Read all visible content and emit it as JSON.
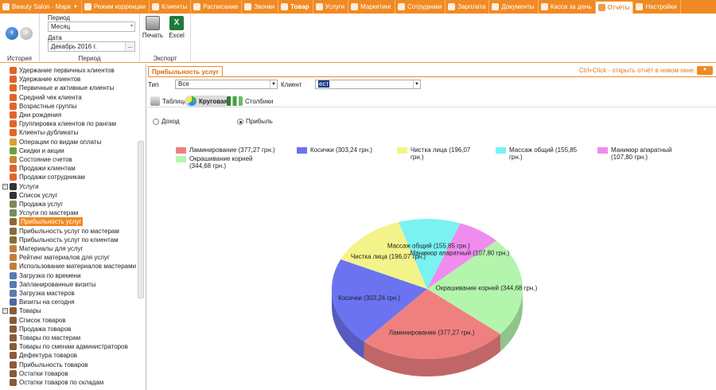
{
  "menubar": {
    "items": [
      {
        "label": "Beauty Salon - Марк",
        "caret": "▼",
        "bold": false,
        "active": false,
        "color": "#ffffff"
      },
      {
        "label": "Режим коррекции",
        "bold": false,
        "active": false
      },
      {
        "label": "Клиенты",
        "bold": false,
        "active": false
      },
      {
        "label": "Расписание",
        "bold": false,
        "active": false
      },
      {
        "label": "Звонки",
        "bold": false,
        "active": false
      },
      {
        "label": "Товар",
        "bold": true,
        "active": false
      },
      {
        "label": "Услуги",
        "bold": false,
        "active": false
      },
      {
        "label": "Маркетинг",
        "bold": false,
        "active": false
      },
      {
        "label": "Сотрудники",
        "bold": false,
        "active": false
      },
      {
        "label": "Зарплата",
        "bold": false,
        "active": false
      },
      {
        "label": "Документы",
        "bold": false,
        "active": false
      },
      {
        "label": "Касса за день",
        "bold": false,
        "active": false
      },
      {
        "label": "Отчёты",
        "bold": false,
        "active": true
      },
      {
        "label": "Настройки",
        "bold": false,
        "active": false
      }
    ]
  },
  "ribbon": {
    "history_label": "История",
    "period_group_label": "Период",
    "period_label": "Период",
    "period_value": "Месяц",
    "date_label": "Дата",
    "date_value": "Декабрь 2016 г.",
    "date_button": "...",
    "export_group_label": "Экспорт",
    "print_label": "Печать",
    "excel_label": "Excel",
    "excel_glyph": "X"
  },
  "sidebar": {
    "items": [
      {
        "label": "Удержание первичных клиентов",
        "level": 1,
        "icon": "person-icon"
      },
      {
        "label": "Удержание клиентов",
        "level": 1,
        "icon": "person-icon"
      },
      {
        "label": "Первичные и активные клиенты",
        "level": 1,
        "icon": "person-icon"
      },
      {
        "label": "Средний чек клиента",
        "level": 1,
        "icon": "person-icon"
      },
      {
        "label": "Возрастные группы",
        "level": 1,
        "icon": "person-icon"
      },
      {
        "label": "Дни рождения",
        "level": 1,
        "icon": "person-icon"
      },
      {
        "label": "Группировка клиентов по рангам",
        "level": 1,
        "icon": "person-icon"
      },
      {
        "label": "Клиенты-дубликаты",
        "level": 1,
        "icon": "person-icon"
      },
      {
        "label": "Операции по видам оплаты",
        "level": 1,
        "icon": "money-icon"
      },
      {
        "label": "Скидки и акции",
        "level": 1,
        "icon": "discount-icon"
      },
      {
        "label": "Состояние счетов",
        "level": 1,
        "icon": "account-icon"
      },
      {
        "label": "Продажи клиентам",
        "level": 1,
        "icon": "person-icon"
      },
      {
        "label": "Продажи сотрудникам",
        "level": 1,
        "icon": "person-icon"
      },
      {
        "label": "Услуги",
        "level": 0,
        "icon": "service-icon",
        "expander": "−"
      },
      {
        "label": "Список услуг",
        "level": 1,
        "icon": "service-icon"
      },
      {
        "label": "Продажа услуг",
        "level": 1,
        "icon": "sale-icon"
      },
      {
        "label": "Услуги по мастерам",
        "level": 1,
        "icon": "sale-icon"
      },
      {
        "label": "Прибыльность услуг",
        "level": 1,
        "icon": "profit-icon",
        "selected": true
      },
      {
        "label": "Прибыльность услуг по мастерам",
        "level": 1,
        "icon": "profit-icon"
      },
      {
        "label": "Прибыльность услуг по клиентам",
        "level": 1,
        "icon": "profit-icon"
      },
      {
        "label": "Материалы для услуг",
        "level": 1,
        "icon": "material-icon"
      },
      {
        "label": "Рейтинг материалов для услуг",
        "level": 1,
        "icon": "material-icon"
      },
      {
        "label": "Использование материалов мастерами",
        "level": 1,
        "icon": "material-icon"
      },
      {
        "label": "Загрузка по времени",
        "level": 1,
        "icon": "schedule-icon"
      },
      {
        "label": "Запланированные визиты",
        "level": 1,
        "icon": "schedule-icon"
      },
      {
        "label": "Загрузка мастеров",
        "level": 1,
        "icon": "schedule-icon"
      },
      {
        "label": "Визиты на сегодня",
        "level": 1,
        "icon": "calendar-icon"
      },
      {
        "label": "Товары",
        "level": 0,
        "icon": "goods-icon",
        "expander": "−"
      },
      {
        "label": "Список товаров",
        "level": 1,
        "icon": "goods-icon"
      },
      {
        "label": "Продажа товаров",
        "level": 1,
        "icon": "goods-icon"
      },
      {
        "label": "Товары по мастерам",
        "level": 1,
        "icon": "goods-icon"
      },
      {
        "label": "Товары по сменам администраторов",
        "level": 1,
        "icon": "goods-icon"
      },
      {
        "label": "Дефектура товаров",
        "level": 1,
        "icon": "goods-icon"
      },
      {
        "label": "Прибыльность товаров",
        "level": 1,
        "icon": "goods-icon"
      },
      {
        "label": "Остатки товаров",
        "level": 1,
        "icon": "goods-icon"
      },
      {
        "label": "Остатки товаров по складам",
        "level": 1,
        "icon": "goods-icon"
      }
    ]
  },
  "main": {
    "tab_label": "Прибыльность услуг",
    "hint": "Ctrl+Click - открыть отчёт в новом окне",
    "hint_button": "▼",
    "type_label": "Тип",
    "type_value": "Все",
    "client_label": "Клиент",
    "client_value": "ест",
    "combo_arrow": "▼",
    "view_tabs": [
      {
        "label": "Таблица",
        "active": false
      },
      {
        "label": "Круговая",
        "active": true
      },
      {
        "label": "Столбики",
        "active": false
      }
    ],
    "radio_income": "Доход",
    "radio_profit": "Прибыль",
    "selected_radio": "profit"
  },
  "chart_data": {
    "type": "pie",
    "series": [
      {
        "name": "Ламинирование (377,27 грн.)",
        "value": 377.27,
        "color": "#f08080"
      },
      {
        "name": "Косички (303,24 грн.)",
        "value": 303.24,
        "color": "#6b73f0"
      },
      {
        "name": "Чистка лица (196,07 грн.)",
        "value": 196.07,
        "color": "#f3f38a"
      },
      {
        "name": "Массаж общий (155,85 грн.)",
        "value": 155.85,
        "color": "#7af2f2"
      },
      {
        "name": "Маникюр апаратный (107,80 грн.)",
        "value": 107.8,
        "color": "#f08cf0"
      },
      {
        "name": "Окрашивание корней (344,68 грн.)",
        "value": 344.68,
        "color": "#b4f5ad"
      }
    ],
    "slice_labels": [
      "Ламинирование (377,27 грн.)",
      "Косички (303,24 грн.)",
      "Чистка лица (196,07 грн.)",
      "Массаж общий (155,85 грн.)",
      "Маникюр апаратный (107,80 грн.)",
      "Окрашивание корней (344,68 грн.)"
    ],
    "legend_position": "top",
    "accent": "#f08a24"
  }
}
